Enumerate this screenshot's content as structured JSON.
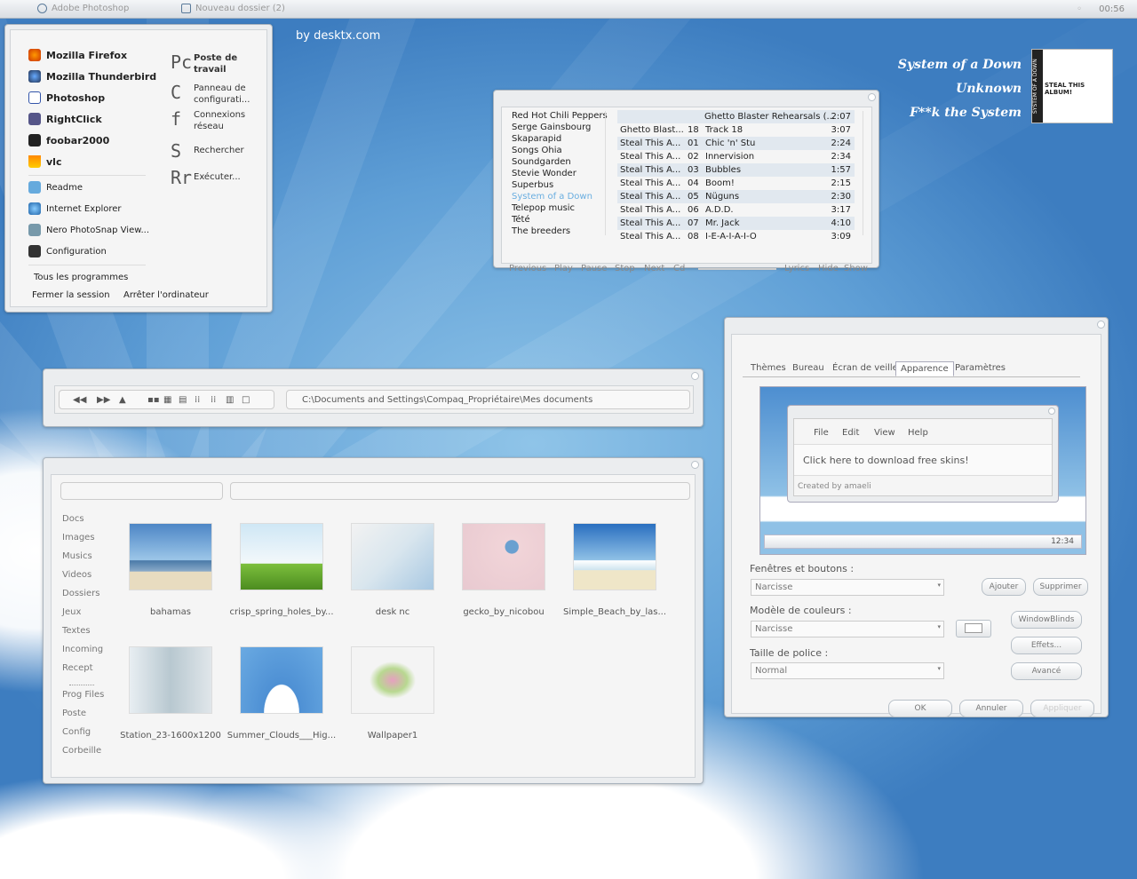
{
  "taskbar": {
    "items": [
      "Adobe Photoshop",
      "Nouveau dossier (2)"
    ],
    "clock": "00:56"
  },
  "credit": "by desktx.com",
  "now_playing": {
    "artist": "System of a Down",
    "album": "Unknown",
    "track": "F**k the System",
    "cover_text": "STEAL THIS ALBUM!",
    "spine_text": "SYSTEM OF A DOWN"
  },
  "start_menu": {
    "pinned": [
      "Mozilla Firefox",
      "Mozilla Thunderbird",
      "Photoshop",
      "RightClick",
      "foobar2000",
      "vlc"
    ],
    "recent": [
      "Readme",
      "Internet Explorer",
      "Nero PhotoSnap View...",
      "Configuration"
    ],
    "right": [
      {
        "glyph": "Pc",
        "label": "Poste de travail"
      },
      {
        "glyph": "C",
        "label": "Panneau de configurati..."
      },
      {
        "glyph": "f",
        "label": "Connexions réseau"
      },
      {
        "glyph": "S",
        "label": "Rechercher"
      },
      {
        "glyph": "Rr",
        "label": "Exécuter..."
      }
    ],
    "all_programs": "Tous les programmes",
    "logoff": "Fermer la session",
    "shutdown": "Arrêter l'ordinateur"
  },
  "foobar": {
    "artists": [
      "Red Hot Chili Peppers",
      "Serge Gainsbourg",
      "Skaparapid",
      "Songs Ohia",
      "Soundgarden",
      "Stevie Wonder",
      "Superbus",
      "System of a Down",
      "Telepop music",
      "Tété",
      "The breeders"
    ],
    "selected_artist": "System of a Down",
    "header": {
      "title": "Ghetto Blaster Rehearsals (...",
      "time": "2:07"
    },
    "tracks": [
      {
        "album": "Ghetto Blast...",
        "no": "18",
        "title": "Track 18",
        "time": "3:07"
      },
      {
        "album": "Steal This A...",
        "no": "01",
        "title": "Chic 'n' Stu",
        "time": "2:24"
      },
      {
        "album": "Steal This A...",
        "no": "02",
        "title": "Innervision",
        "time": "2:34"
      },
      {
        "album": "Steal This A...",
        "no": "03",
        "title": "Bubbles",
        "time": "1:57"
      },
      {
        "album": "Steal This A...",
        "no": "04",
        "title": "Boom!",
        "time": "2:15"
      },
      {
        "album": "Steal This A...",
        "no": "05",
        "title": "Nüguns",
        "time": "2:30"
      },
      {
        "album": "Steal This A...",
        "no": "06",
        "title": "A.D.D.",
        "time": "3:17"
      },
      {
        "album": "Steal This A...",
        "no": "07",
        "title": "Mr. Jack",
        "time": "4:10"
      },
      {
        "album": "Steal This A...",
        "no": "08",
        "title": "I-E-A-I-A-I-O",
        "time": "3:09"
      }
    ],
    "controls": [
      "Previous",
      "Play",
      "Pause",
      "Stop",
      "Next",
      "Cd"
    ],
    "right_controls": [
      "Lyrics",
      "Hide",
      "Show"
    ]
  },
  "explorer_toolbar": {
    "path": "C:\\Documents and Settings\\Compaq_Propriétaire\\Mes documents"
  },
  "explorer": {
    "sidebar": [
      "Docs",
      "Images",
      "Musics",
      "Videos",
      "Dossiers",
      "Jeux",
      "Textes",
      "Incoming",
      "Recept",
      "Prog Files",
      "Poste",
      "Config",
      "Corbeille"
    ],
    "files": [
      "bahamas",
      "crisp_spring_holes_by...",
      "desk nc",
      "gecko_by_nicobou",
      "Simple_Beach_by_las...",
      "Station_23-1600x1200",
      "Summer_Clouds___Hig...",
      "Wallpaper1"
    ]
  },
  "display": {
    "tabs": [
      "Thèmes",
      "Bureau",
      "Écran de veille",
      "Apparence",
      "Paramètres"
    ],
    "selected_tab": "Apparence",
    "preview": {
      "menu": [
        "File",
        "Edit",
        "View",
        "Help"
      ],
      "text": "Click here to download free skins!",
      "footer": "Created by amaeli",
      "clock": "12:34"
    },
    "windows_label": "Fenêtres et boutons :",
    "windows_value": "Narcisse",
    "color_label": "Modèle de couleurs :",
    "color_value": "Narcisse",
    "font_label": "Taille de police :",
    "font_value": "Normal",
    "buttons": {
      "add": "Ajouter",
      "delete": "Supprimer",
      "wb": "WindowBlinds",
      "effects": "Effets...",
      "advanced": "Avancé",
      "ok": "OK",
      "cancel": "Annuler",
      "apply": "Appliquer"
    }
  }
}
